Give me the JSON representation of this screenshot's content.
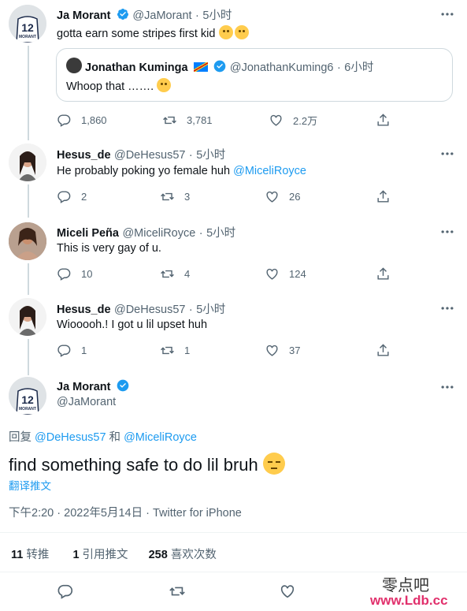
{
  "tweets": [
    {
      "name": "Ja Morant",
      "handle": "@JaMorant",
      "time": "5小时",
      "text": "gotta earn some stripes first kid",
      "replies": "1,860",
      "retweets": "3,781",
      "likes": "2.2万"
    },
    {
      "name": "Hesus_de",
      "handle": "@DeHesus57",
      "time": "5小时",
      "text": "He probably poking yo female huh ",
      "mention": "@MiceliRoyce",
      "replies": "2",
      "retweets": "3",
      "likes": "26"
    },
    {
      "name": "Miceli Peña",
      "handle": "@MiceliRoyce",
      "time": "5小时",
      "text": "This is very gay of u.",
      "replies": "10",
      "retweets": "4",
      "likes": "124"
    },
    {
      "name": "Hesus_de",
      "handle": "@DeHesus57",
      "time": "5小时",
      "text": "Wiooooh.! I got u lil upset huh",
      "replies": "1",
      "retweets": "1",
      "likes": "37"
    }
  ],
  "quote": {
    "name": "Jonathan Kuminga",
    "handle": "@JonathanKuming6",
    "time": "6小时",
    "text": "Whoop that ……."
  },
  "sep": "·",
  "main": {
    "name": "Ja Morant",
    "handle": "@JaMorant",
    "reply_prefix": "回复 ",
    "reply_to_1": "@DeHesus57",
    "reply_and": " 和 ",
    "reply_to_2": "@MiceliRoyce",
    "text": "find something safe to do lil bruh",
    "translate": "翻译推文",
    "time": "下午2:20",
    "date": "2022年5月14日",
    "source": "Twitter for iPhone",
    "retweets_count": "11",
    "retweets_label": "转推",
    "quotes_count": "1",
    "quotes_label": "引用推文",
    "likes_count": "258",
    "likes_label": "喜欢次数"
  },
  "avatar_jersey": "12",
  "avatar_jersey_name": "MORANT",
  "watermark": "零点吧",
  "watermark_url": "www.Ldb.cc",
  "colors": {
    "accent": "#1d9bf0",
    "muted": "#536471"
  }
}
